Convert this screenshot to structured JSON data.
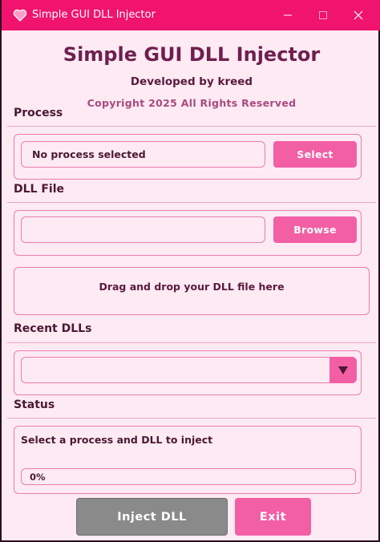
{
  "window": {
    "title": "Simple GUI DLL Injector",
    "accent_color": "#f0146e",
    "button_color": "#f25fa5",
    "background_color": "#fdeaf3",
    "icon": "heart-icon"
  },
  "header": {
    "title": "Simple GUI DLL Injector",
    "developer": "Developed by kreed",
    "copyright": "Copyright 2025 All Rights Reserved"
  },
  "process": {
    "label": "Process",
    "field_value": "No process selected",
    "select_label": "Select"
  },
  "dll": {
    "label": "DLL File",
    "field_value": "",
    "browse_label": "Browse",
    "drop_text": "Drag and drop your DLL file here"
  },
  "recent": {
    "label": "Recent DLLs",
    "selected": ""
  },
  "status": {
    "label": "Status",
    "message": "Select a process and DLL to inject",
    "progress_text": "0%",
    "progress_value": 0
  },
  "actions": {
    "inject_label": "Inject DLL",
    "exit_label": "Exit"
  }
}
